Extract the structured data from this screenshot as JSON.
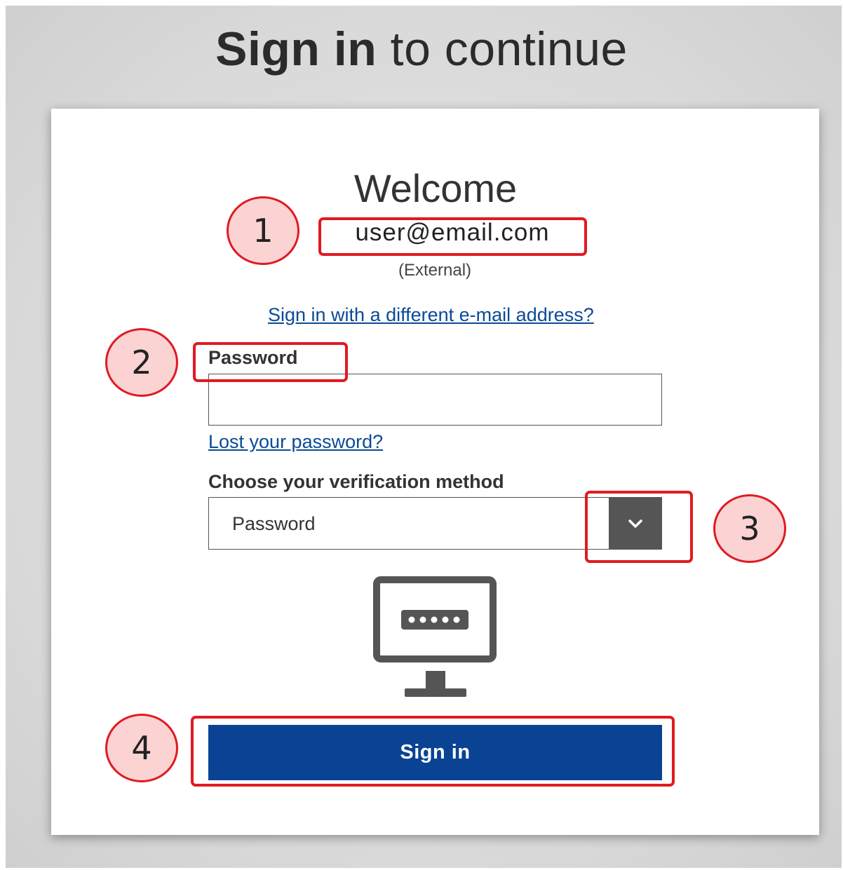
{
  "heading": {
    "bold": "Sign in",
    "rest": " to continue"
  },
  "welcome": {
    "title": "Welcome",
    "email": "user@email.com",
    "account_type": "(External)",
    "different_email_link": "Sign in with a different e-mail address?"
  },
  "password": {
    "label": "Password",
    "value": "",
    "lost_link": "Lost your password?"
  },
  "verification": {
    "label": "Choose your verification method",
    "selected": "Password",
    "icon": "chevron-down-icon"
  },
  "method_icon": "monitor-password-icon",
  "signin_button": {
    "label": "Sign in"
  },
  "annotations": {
    "callouts": [
      "1",
      "2",
      "3",
      "4"
    ],
    "color": "#e01a22",
    "fill": "#fbd3d3"
  },
  "colors": {
    "primary_button": "#0a4393",
    "link": "#0b4a96",
    "dropdown_arrow_bg": "#555555"
  }
}
